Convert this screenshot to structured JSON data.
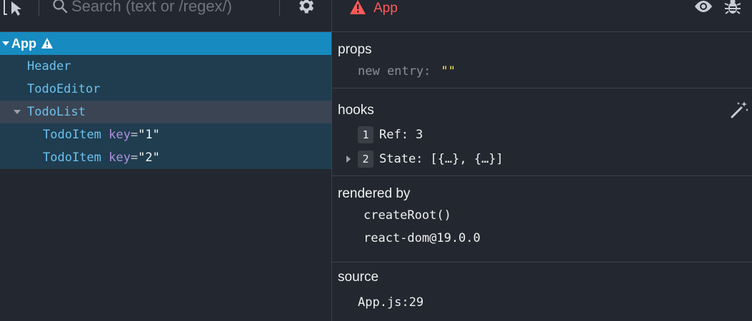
{
  "toolbar": {
    "search_placeholder": "Search (text or /regex/)"
  },
  "tree": {
    "items": [
      {
        "name": "App",
        "warning": true
      },
      {
        "name": "Header"
      },
      {
        "name": "TodoEditor"
      },
      {
        "name": "TodoList"
      },
      {
        "name": "TodoItem",
        "key_label": "key",
        "key_value": "\"1\""
      },
      {
        "name": "TodoItem",
        "key_label": "key",
        "key_value": "\"2\""
      }
    ]
  },
  "inspector": {
    "component_name": "App",
    "props": {
      "title": "props",
      "new_entry_label": "new entry",
      "new_entry_value": "\"\""
    },
    "hooks": {
      "title": "hooks",
      "items": [
        {
          "index": "1",
          "name": "Ref:",
          "value": "3"
        },
        {
          "index": "2",
          "name": "State:",
          "value": "[{…}, {…}]"
        }
      ]
    },
    "rendered_by": {
      "title": "rendered by",
      "items": [
        "createRoot()",
        "react-dom@19.0.0"
      ]
    },
    "source": {
      "title": "source",
      "location": "App.js:29"
    }
  },
  "colors": {
    "selected_bg": "#178ac0",
    "owner_bg": "#1f3d4f",
    "hover_bg": "#3a4452",
    "component_text": "#6cc1ef",
    "warning": "#ff5a5a",
    "prop_string": "#f7e061",
    "key_attr": "#b08fe0"
  },
  "icons": {
    "inspect": "select-element-icon",
    "search": "search-icon",
    "settings": "gear-icon",
    "warning": "warning-triangle-icon",
    "eye": "eye-icon",
    "bug": "bug-icon",
    "magic": "magic-wand-icon"
  }
}
